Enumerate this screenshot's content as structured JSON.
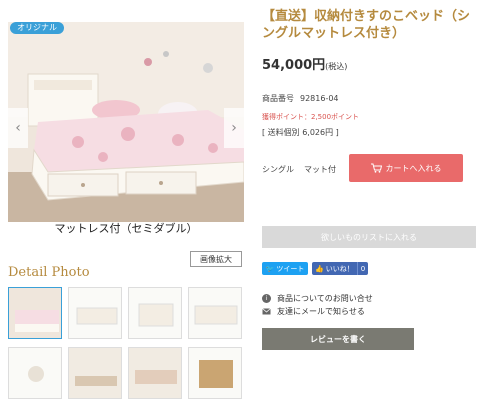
{
  "gallery": {
    "badge": "オリジナル",
    "prev_arrow": "‹",
    "next_arrow": "›",
    "caption": "マットレス付（セミダブル）",
    "zoom_label": "画像拡大",
    "detail_title": "Detail Photo",
    "thumbnail_count": 12
  },
  "product": {
    "title": "【直送】収納付きすのこベッド（シングルマットレス付き）",
    "price": "54,000円",
    "price_tax": "(税込)",
    "sku_label": "商品番号",
    "sku_value": "92816-04",
    "points": "獲得ポイント：2,500ポイント",
    "shipping": "[ 送料個別 6,026円 ]",
    "option1": "シングル",
    "option2": "マット付",
    "cart_label": "カートへ入れる",
    "wishlist_label": "欲しいものリストに入れる"
  },
  "social": {
    "tweet_label": "ツイート",
    "like_label": "いいね！",
    "like_count": "0"
  },
  "links": {
    "inquiry": "商品についてのお問い合せ",
    "tell_friend": "友達にメールで知らせる"
  },
  "review": {
    "label": "レビューを書く"
  },
  "colors": {
    "accent_gold": "#b58a3e",
    "cart_red": "#e96a6a",
    "twitter_blue": "#1da1f2",
    "facebook_blue": "#4267b2",
    "review_gray": "#7a7a72",
    "wishlist_gray": "#d9d9d9"
  }
}
